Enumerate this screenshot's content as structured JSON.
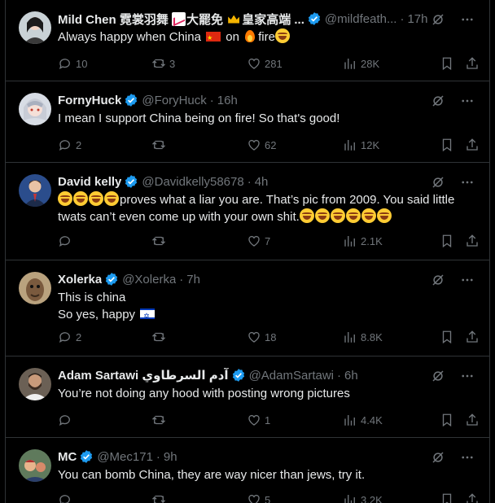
{
  "colors": {
    "background": "#000000",
    "text": "#e7e9ea",
    "muted": "#71767b",
    "verified": "#1d9bf0",
    "divider": "#2f3336"
  },
  "tweets": [
    {
      "name": "Mild Chen 霓裳羽舞",
      "name_suffix_1": "大罷免",
      "name_suffix_2": "皇家高端 ...",
      "handle": "@mildfeath...",
      "time": "17h",
      "text_1": "Always happy when China",
      "text_2": "on",
      "text_3": "fire",
      "replies": "10",
      "retweets": "3",
      "likes": "281",
      "views": "28K",
      "avatar": "woman-avatar"
    },
    {
      "name": "FornyHuck",
      "handle": "@ForyHuck",
      "time": "16h",
      "text": "I mean I support China being on fire! So that's good!",
      "replies": "2",
      "retweets": "",
      "likes": "62",
      "views": "12K",
      "avatar": "anime-avatar"
    },
    {
      "name": "David kelly",
      "handle": "@Davidkelly58678",
      "time": "4h",
      "text_1": "proves what a liar you are. That’s pic from 2009. You said little",
      "text_2": "twats can’t even come up with your own shit.",
      "replies": "",
      "retweets": "",
      "likes": "7",
      "views": "2.1K",
      "avatar": "man-suit-avatar"
    },
    {
      "name": "Xolerka",
      "handle": "@Xolerka",
      "time": "7h",
      "text_1": "This is china",
      "text_2": "So yes, happy",
      "replies": "2",
      "retweets": "",
      "likes": "18",
      "views": "8.8K",
      "avatar": "creature-avatar"
    },
    {
      "name": "Adam Sartawi آدم السرطاوي",
      "handle": "@AdamSartawi",
      "time": "6h",
      "text": "You’re not doing any hood with posting wrong pictures",
      "replies": "",
      "retweets": "",
      "likes": "1",
      "views": "4.4K",
      "avatar": "bearded-man-avatar"
    },
    {
      "name": "MC",
      "handle": "@Mec171",
      "time": "9h",
      "text": "You can bomb China, they are way nicer than jews, try it.",
      "replies": "",
      "retweets": "",
      "likes": "5",
      "views": "3.2K",
      "avatar": "cartoon-avatar"
    }
  ]
}
